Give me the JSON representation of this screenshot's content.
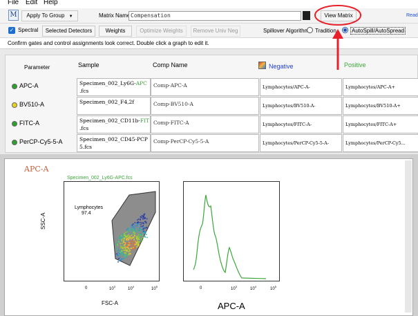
{
  "menu": {
    "file": "File",
    "edit": "Edit",
    "help": "Help"
  },
  "toolbar": {
    "app_icon_letter": "M",
    "apply_to_group": "Apply To Group",
    "matrix_name_label": "Matrix Name:",
    "matrix_name_value": "Compensation",
    "view_matrix": "View Matrix",
    "ready": "Read"
  },
  "controls": {
    "spectral_label": "Spectral",
    "spectral_checked": true,
    "selected_detectors": "Selected Detectors",
    "weights": "Weights",
    "optimize_weights": "Optimize Weights",
    "remove_univ_neg": "Remove Univ Neg",
    "spillover_label": "Spillover Algorithm",
    "algo_traditional": "Tradition",
    "algo_autospill": "AutoSpill/AutoSpread"
  },
  "info": {
    "message": "Confirm gates and control assignments look correct. Double click a graph to edit it."
  },
  "table": {
    "headers": {
      "parameter": "Parameter",
      "sample": "Sample",
      "comp_name": "Comp Name",
      "negative": "Negative",
      "positive": "Positive"
    },
    "rows": [
      {
        "param": "APC-A",
        "dot": "#2e9e2e",
        "sample1": "Specimen_002_Ly6G-",
        "sample_hl": "APC",
        "sample2": ".fcs",
        "comp": "Comp-APC-A",
        "neg": "Lymphocytes/APC-A-",
        "pos": "Lymphocytes/APC-A+"
      },
      {
        "param": "BV510-A",
        "dot": "#e3d423",
        "sample1": "Specimen_002_F4,2f",
        "sample_hl": "",
        "sample2": "",
        "comp": "Comp-BV510-A",
        "neg": "Lymphocytes/BV510-A-",
        "pos": "Lymphocytes/BV510-A+"
      },
      {
        "param": "FITC-A",
        "dot": "#2e9e2e",
        "sample1": "Specimen_002_CD11b-",
        "sample_hl": "FIT",
        "sample2": ".fcs",
        "comp": "Comp-FITC-A",
        "neg": "Lymphocytes/FITC-A-",
        "pos": "Lymphocytes/FITC-A+"
      },
      {
        "param": "PerCP-Cy5-5-A",
        "dot": "#2e9e2e",
        "sample1": "Specimen_002_CD45-PCP",
        "sample_hl": "",
        "sample2": "5.fcs",
        "comp": "Comp-PerCP-Cy5-5-A",
        "neg": "Lymphocytes/PerCP-Cy5-5-A-",
        "pos": "Lymphocytes/PerCP-Cy5..."
      }
    ]
  },
  "panel": {
    "title": "APC-A",
    "scatter_title": "Specimen_002_Ly6G-APC.fcs",
    "gate_name": "Lymphocytes",
    "gate_value": "97.4",
    "scatter_xlabel": "FSC-A",
    "scatter_ylabel": "SSC-A",
    "hist_xlabel": "APC-A",
    "tick_0": "0",
    "tick_3": "10",
    "tick_4": "10",
    "tick_5": "10",
    "exp_3": "3",
    "exp_4": "4",
    "exp_5": "5"
  },
  "colors": {
    "annotation_red": "#e8202a",
    "green": "#3aa63a",
    "negative_blue": "#1f3fd6",
    "positive_green": "#3aa63a"
  }
}
